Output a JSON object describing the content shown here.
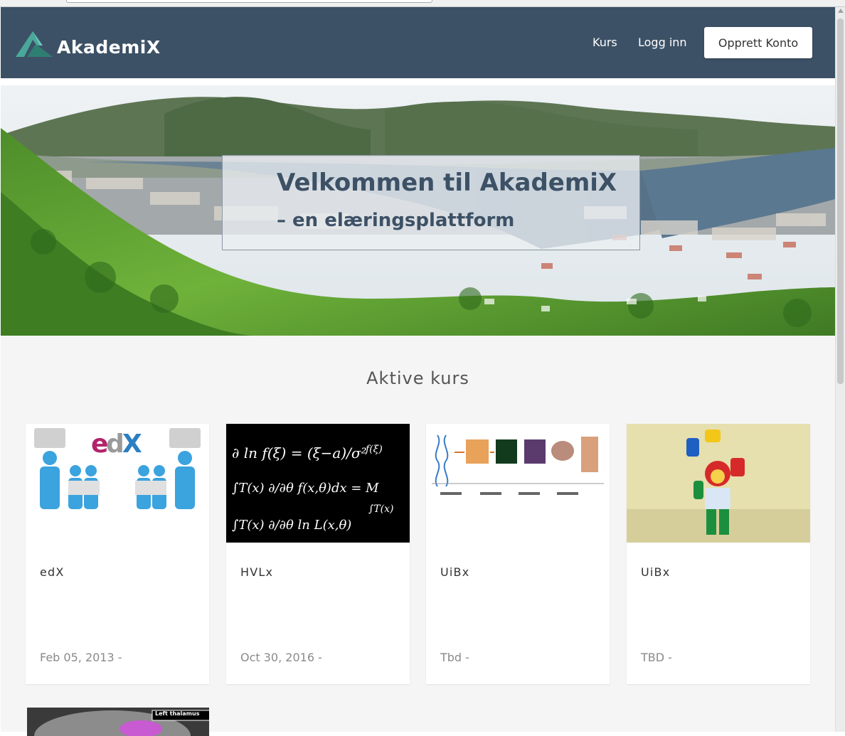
{
  "header": {
    "logo_text": "AkademiX",
    "nav": {
      "courses": "Kurs",
      "login": "Logg inn"
    },
    "signup_label": "Opprett Konto",
    "bg_color": "#3d5166"
  },
  "hero": {
    "title": "Velkommen til AkademiX",
    "subtitle": "– en elæringsplattform"
  },
  "main": {
    "section_title": "Aktive kurs",
    "courses": [
      {
        "code": "edX",
        "date": "Feb 05, 2013 -",
        "image": "edx-puzzle-people"
      },
      {
        "code": "HVLx",
        "date": "Oct 30, 2016 -",
        "image": "math-formulas-blackboard"
      },
      {
        "code": "UiBx",
        "date": "Tbd -",
        "image": "biology-scale-diagram"
      },
      {
        "code": "UiBx",
        "date": "TBD -",
        "image": "lego-juggler"
      }
    ],
    "fifth_card_label": "Left thalamus"
  }
}
